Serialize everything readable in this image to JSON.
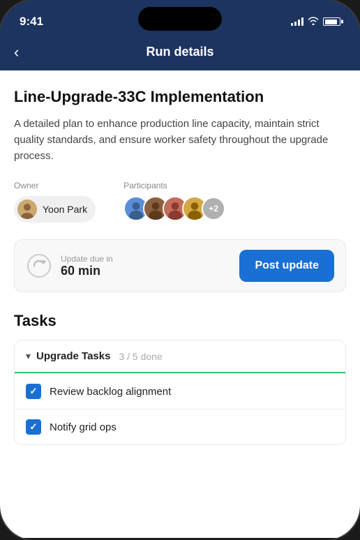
{
  "status_bar": {
    "time": "9:41"
  },
  "header": {
    "title": "Run details",
    "back_label": "‹"
  },
  "run": {
    "title": "Line-Upgrade-33C Implementation",
    "description": "A detailed plan to enhance production line capacity, maintain strict quality standards, and ensure worker safety throughout the upgrade process.",
    "owner_label": "Owner",
    "owner_name": "Yoon Park",
    "participants_label": "Participants",
    "participants_extra": "+2"
  },
  "update_card": {
    "due_label": "Update due in",
    "due_value": "60 min",
    "button_label": "Post update"
  },
  "tasks": {
    "section_title": "Tasks",
    "group_name": "Upgrade Tasks",
    "group_progress": "3 / 5 done",
    "items": [
      {
        "label": "Review backlog alignment",
        "done": true
      },
      {
        "label": "Notify grid ops",
        "done": true
      }
    ]
  }
}
